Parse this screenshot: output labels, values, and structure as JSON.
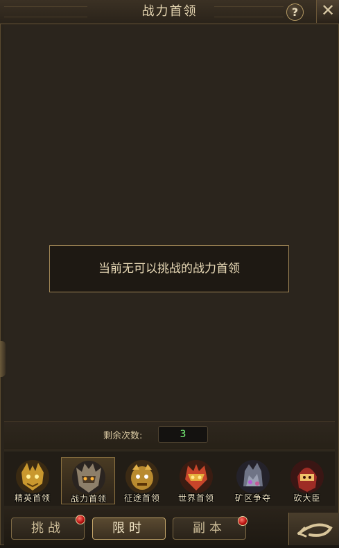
{
  "header": {
    "title": "战力首领",
    "help_label": "?",
    "close_label": "✕"
  },
  "notice": {
    "text": "当前无可以挑战的战力首领"
  },
  "remaining": {
    "label": "剩余次数:",
    "value": "3"
  },
  "boss_tabs": [
    {
      "label": "精英首领",
      "icon": "golden-demon-icon",
      "active": false
    },
    {
      "label": "战力首领",
      "icon": "armored-warlord-icon",
      "active": true
    },
    {
      "label": "征途首领",
      "icon": "golden-beast-icon",
      "active": false
    },
    {
      "label": "世界首领",
      "icon": "red-dragon-icon",
      "active": false
    },
    {
      "label": "矿区争夺",
      "icon": "stone-golem-icon",
      "active": false
    },
    {
      "label": "砍大臣",
      "icon": "red-demon-icon",
      "active": false
    }
  ],
  "bottom_tabs": [
    {
      "label": "挑战",
      "active": false,
      "has_dot": true
    },
    {
      "label": "限时",
      "active": true,
      "has_dot": false
    },
    {
      "label": "副本",
      "active": false,
      "has_dot": true
    }
  ],
  "colors": {
    "accent": "#c4a66a",
    "count": "#7dff7d",
    "badge": "#b30d0d"
  }
}
